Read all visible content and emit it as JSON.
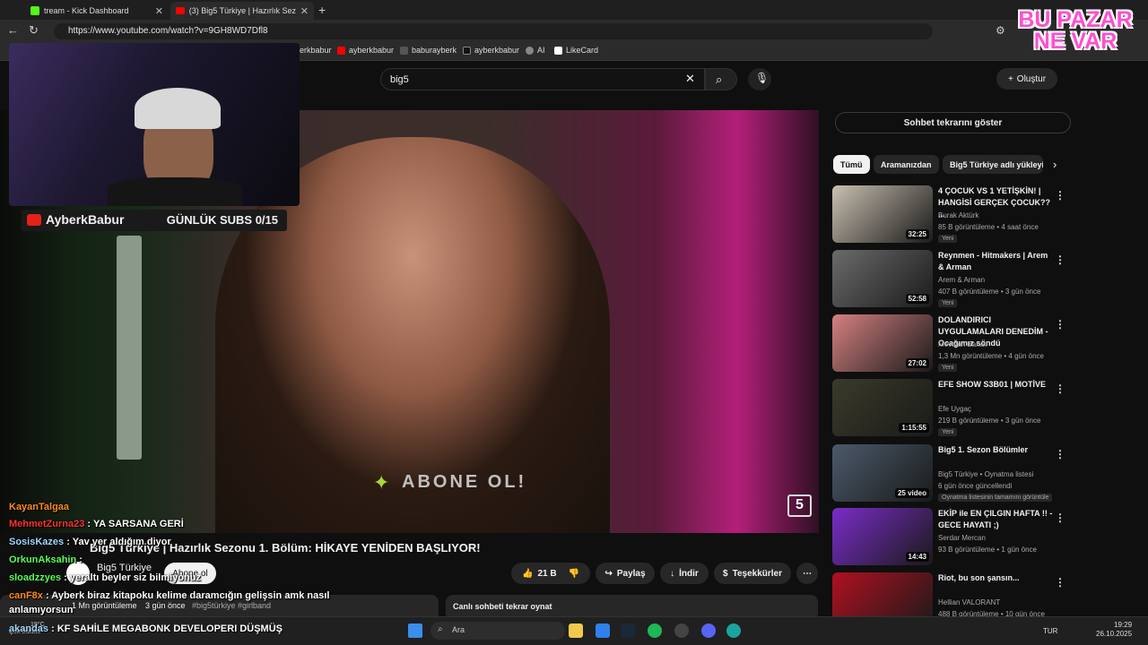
{
  "browser": {
    "tabs": [
      {
        "label": "tream - Kick Dashboard"
      },
      {
        "label": "(3) Big5 Türkiye | Hazırlık Sezonu"
      }
    ],
    "url": "https://www.youtube.com/watch?v=9GH8WD7Dfl8",
    "bookmarks": [
      "erkbabur",
      "ayberkbabur",
      "baburayberk",
      "ayberkbabur",
      "AI",
      "LikeCard"
    ]
  },
  "youtube": {
    "search_value": "big5",
    "create_label": "Oluştur",
    "video": {
      "title": "Big5 Türkiye | Hazırlık Sezonu 1. Bölüm: HİKAYE YENİDEN BAŞLIYOR!",
      "watermark": "ABONE OL!",
      "channel": "Big5 Türkiye",
      "subscribe_label": "Abone ol",
      "likes": "21 B",
      "share_label": "Paylaş",
      "download_label": "İndir",
      "thanks_label": "Teşekkürler",
      "views": "1 Mn görüntüleme",
      "date": "3 gün önce",
      "hashtags": "#big5türkiye #girlband",
      "chat_replay_label": "Canlı sohbeti tekrar oynat"
    },
    "sidebar": {
      "chat_button": "Sohbet tekrarını göster",
      "chips": [
        "Tümü",
        "Aramanızdan",
        "Big5 Türkiye adlı yükleyi"
      ],
      "items": [
        {
          "title": "4 ÇOCUK VS 1 YETİŞKİN! | HANGİSİ GERÇEK ÇOCUK?? ...",
          "channel": "Burak Aktürk",
          "meta": "85 B görüntüleme • 4 saat önce",
          "badge": "Yeni",
          "duration": "32:25",
          "thumb": "#c9c0b0"
        },
        {
          "title": "Reynmen - Hitmakers | Arem & Arman",
          "channel": "Arem & Arman",
          "meta": "407 B görüntüleme • 3 gün önce",
          "badge": "Yeni",
          "duration": "52:58",
          "thumb": "#6b6b6b"
        },
        {
          "title": "DOLANDIRICI UYGULAMALARI DENEDİM - Ocağımız söndü",
          "channel": "Mevtcan Bahav",
          "meta": "1,3 Mn görüntüleme • 4 gün önce",
          "badge": "Yeni",
          "duration": "27:02",
          "thumb": "#d58080"
        },
        {
          "title": "EFE SHOW S3B01 | MOTİVE",
          "channel": "Efe Uygaç",
          "meta": "219 B görüntüleme • 3 gün önce",
          "badge": "Yeni",
          "duration": "1:15:55",
          "thumb": "#3a3a2a"
        },
        {
          "title": "Big5 1. Sezon Bölümler",
          "channel": "Big5 Türkiye • Oynatma listesi",
          "meta": "6 gün önce güncellendi",
          "badge": "Oynatma listesinin tamamını görüntüle",
          "duration": "25 video",
          "thumb": "#4b5a6a"
        },
        {
          "title": "EKİP ile EN ÇILGIN HAFTA !! - GECE HAYATI ;)",
          "channel": "Serdar Mercan",
          "meta": "93 B görüntüleme • 1 gün önce",
          "badge": "",
          "duration": "14:43",
          "thumb": "#7a2cc9"
        },
        {
          "title": "Riot, bu son şansın...",
          "channel": "Hellian VALORANT",
          "meta": "488 B görüntüleme • 10 gün önce",
          "badge": "",
          "duration": "",
          "thumb": "#b01020"
        }
      ]
    }
  },
  "stream_overlay": {
    "streamer_name": "AyberkBabur",
    "subs_goal": "GÜNLÜK SUBS 0/15",
    "brand_text": "BU PAZAR NE VAR",
    "chat": [
      {
        "user": "KayanTalgaa",
        "color": "#ff8a1f",
        "msg": ""
      },
      {
        "user": "MehmetZurna23",
        "color": "#ff3030",
        "msg": "YA SARSANA GERİ"
      },
      {
        "user": "SosisKazes",
        "color": "#9fd7ff",
        "msg": "Yav yer aldığım diyor"
      },
      {
        "user": "OrkunAksahin",
        "color": "#59ff59",
        "msg": ""
      },
      {
        "user": "sloadzzyes",
        "color": "#59ff59",
        "msg": "yeraltı beyler siz bilmiyonuz"
      },
      {
        "user": "canF8x",
        "color": "#ff8a1f",
        "msg": "Ayberk biraz kitapoku kelime daramcığın gelişsin amk nasıl"
      },
      {
        "user": "",
        "color": "#ffffff",
        "msg": "anlamıyorsun"
      }
    ],
    "ticker": "KF SAHİLE MEGABONK DEVELOPERI DÜŞMÜŞ",
    "ticker_user": "akandas"
  },
  "taskbar": {
    "weather_temp": "19°C",
    "weather_desc": "Çok bulutlu",
    "search_placeholder": "Ara",
    "lang": "TUR",
    "time": "19:29",
    "date": "26.10.2025"
  }
}
